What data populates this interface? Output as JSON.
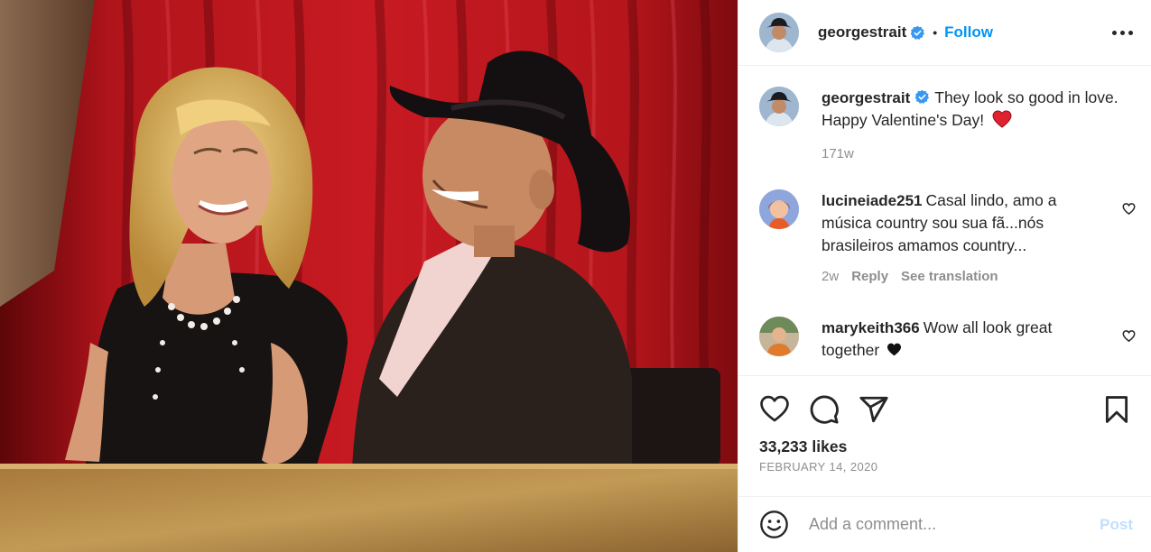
{
  "post": {
    "author": "georgestrait",
    "verified": true,
    "follow_label": "Follow",
    "separator": "•",
    "more_icon": "more-options-icon",
    "caption": {
      "username": "georgestrait",
      "text": "They look so good in love. Happy Valentine's Day!",
      "emoji": "red-heart",
      "age": "171w"
    },
    "comments": [
      {
        "username": "lucineiade251",
        "text": "Casal lindo, amo a música country sou sua fã...nós brasileiros amamos country...",
        "age": "2w",
        "reply_label": "Reply",
        "translate_label": "See translation"
      },
      {
        "username": "marykeith366",
        "text": "Wow all look great together",
        "emoji": "black-heart"
      }
    ],
    "likes": "33,233 likes",
    "date": "FEBRUARY 14, 2020",
    "comment_placeholder": "Add a comment...",
    "post_label": "Post"
  },
  "colors": {
    "link_blue": "#0095f6",
    "post_disabled": "#c0dffd",
    "text": "#262626",
    "secondary": "#8e8e8e",
    "curtain_red": "#b3121a"
  }
}
